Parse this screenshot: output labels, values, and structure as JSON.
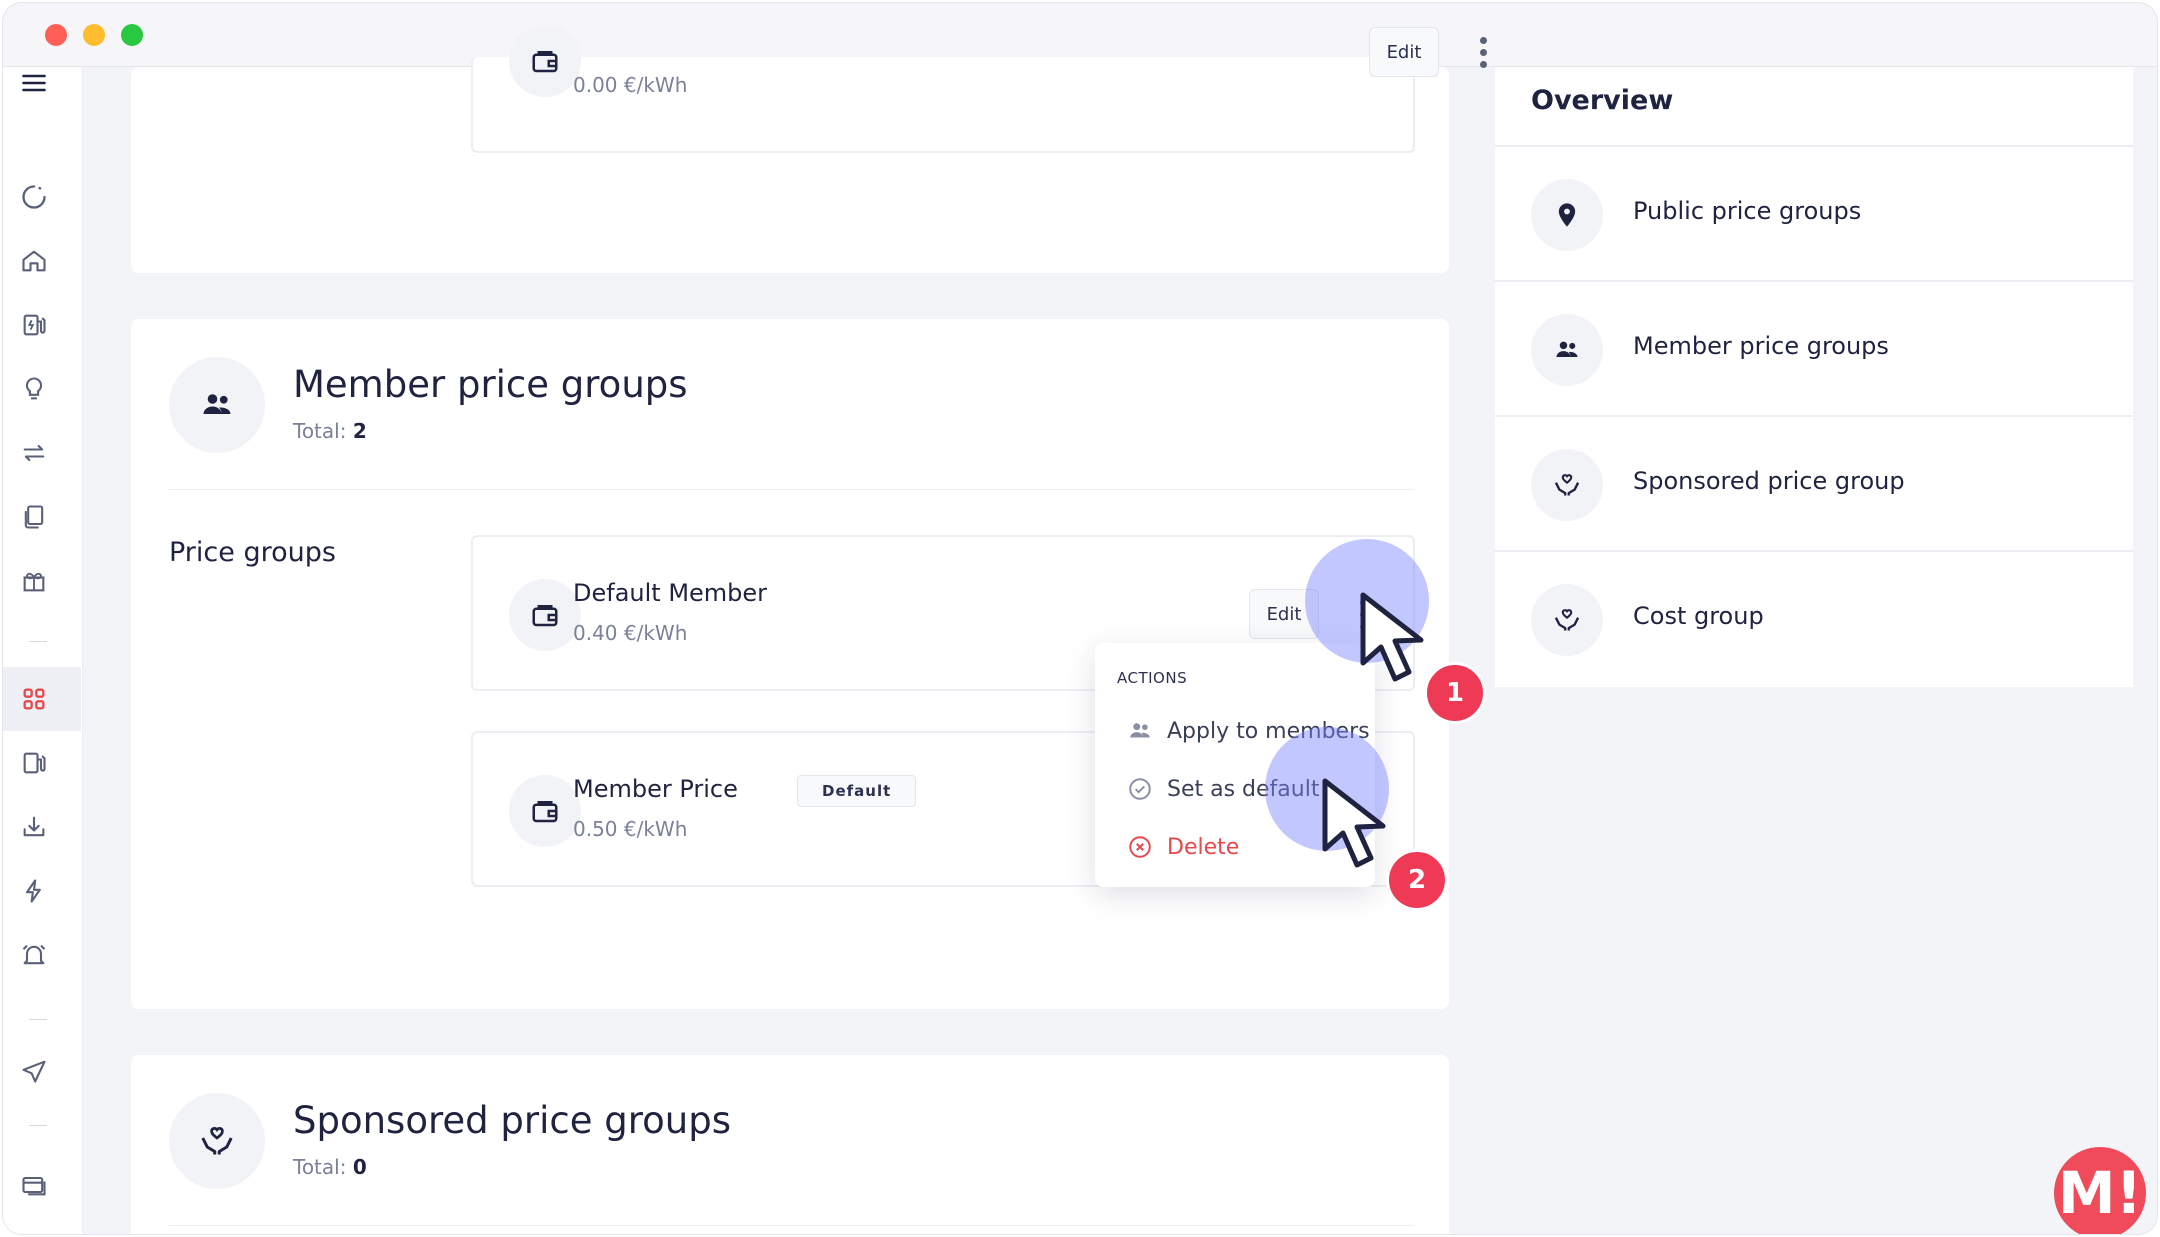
{
  "sidebar": {
    "items": [
      {
        "icon": "menu-icon"
      },
      {
        "icon": "dashboard-loader-icon"
      },
      {
        "icon": "home-icon"
      },
      {
        "icon": "charger-station-icon"
      },
      {
        "icon": "lightbulb-icon"
      },
      {
        "icon": "transfer-arrows-icon"
      },
      {
        "icon": "documents-icon"
      },
      {
        "icon": "gift-icon"
      },
      {
        "icon": "grid-apps-icon",
        "active": true
      },
      {
        "icon": "charger-station-2-icon"
      },
      {
        "icon": "download-icon"
      },
      {
        "icon": "lightning-icon"
      },
      {
        "icon": "alarm-bell-icon"
      },
      {
        "icon": "send-icon"
      },
      {
        "icon": "cards-icon"
      }
    ],
    "active_color": "#e5484d"
  },
  "top_card": {
    "price_group": {
      "price": "0.00 €/kWh",
      "edit_label": "Edit"
    }
  },
  "member_section": {
    "title": "Member price groups",
    "total_label": "Total:",
    "total_value": "2",
    "price_groups_label": "Price groups",
    "groups": [
      {
        "name": "Default Member",
        "price": "0.40 €/kWh",
        "edit_label": "Edit"
      },
      {
        "name": "Member Price",
        "price": "0.50 €/kWh",
        "badge": "Default"
      }
    ]
  },
  "actions_menu": {
    "header": "ACTIONS",
    "items": [
      {
        "label": "Apply to members",
        "icon": "members-icon"
      },
      {
        "label": "Set as default",
        "icon": "check-circle-icon"
      },
      {
        "label": "Delete",
        "icon": "x-circle-icon",
        "danger": true
      }
    ]
  },
  "steps": [
    "1",
    "2"
  ],
  "sponsored_section": {
    "title": "Sponsored price groups",
    "total_label": "Total:",
    "total_value": "0"
  },
  "overview": {
    "title": "Overview",
    "items": [
      {
        "label": "Public price groups",
        "icon": "location-pin-icon"
      },
      {
        "label": "Member price groups",
        "icon": "members-icon"
      },
      {
        "label": "Sponsored price group",
        "icon": "hands-heart-icon"
      },
      {
        "label": "Cost group",
        "icon": "hands-heart-icon"
      }
    ]
  },
  "brand": {
    "letter": "M!",
    "color": "#ef4b5a"
  },
  "colors": {
    "accent": "#7a82ff",
    "danger": "#e5484d",
    "step_badge": "#ef3a56"
  }
}
